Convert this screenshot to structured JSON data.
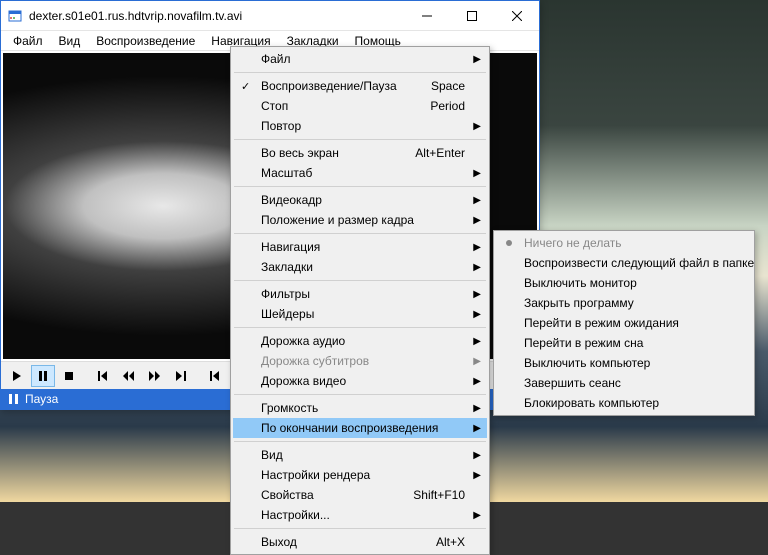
{
  "titlebar": {
    "title": "dexter.s01e01.rus.hdtvrip.novafilm.tv.avi"
  },
  "menubar": {
    "items": [
      "Файл",
      "Вид",
      "Воспроизведение",
      "Навигация",
      "Закладки",
      "Помощь"
    ]
  },
  "status": {
    "label": "Пауза"
  },
  "menu1": [
    {
      "label": "Файл",
      "arrow": true
    },
    {
      "sep": true
    },
    {
      "label": "Воспроизведение/Пауза",
      "shortcut": "Space",
      "checked": true
    },
    {
      "label": "Стоп",
      "shortcut": "Period"
    },
    {
      "label": "Повтор",
      "arrow": true
    },
    {
      "sep": true
    },
    {
      "label": "Во весь экран",
      "shortcut": "Alt+Enter"
    },
    {
      "label": "Масштаб",
      "arrow": true
    },
    {
      "sep": true
    },
    {
      "label": "Видеокадр",
      "arrow": true
    },
    {
      "label": "Положение и размер кадра",
      "arrow": true
    },
    {
      "sep": true
    },
    {
      "label": "Навигация",
      "arrow": true
    },
    {
      "label": "Закладки",
      "arrow": true
    },
    {
      "sep": true
    },
    {
      "label": "Фильтры",
      "arrow": true
    },
    {
      "label": "Шейдеры",
      "arrow": true
    },
    {
      "sep": true
    },
    {
      "label": "Дорожка аудио",
      "arrow": true
    },
    {
      "label": "Дорожка субтитров",
      "arrow": true,
      "disabled": true
    },
    {
      "label": "Дорожка видео",
      "arrow": true
    },
    {
      "sep": true
    },
    {
      "label": "Громкость",
      "arrow": true
    },
    {
      "label": "По окончании воспроизведения",
      "arrow": true,
      "highlight": true
    },
    {
      "sep": true
    },
    {
      "label": "Вид",
      "arrow": true
    },
    {
      "label": "Настройки рендера",
      "arrow": true
    },
    {
      "label": "Свойства",
      "shortcut": "Shift+F10"
    },
    {
      "label": "Настройки...",
      "arrow": true
    },
    {
      "sep": true
    },
    {
      "label": "Выход",
      "shortcut": "Alt+X"
    }
  ],
  "menu2": [
    {
      "label": "Ничего не делать",
      "radio": true,
      "disabled": true
    },
    {
      "label": "Воспроизвести следующий файл в папке"
    },
    {
      "label": "Выключить монитор"
    },
    {
      "label": "Закрыть программу"
    },
    {
      "label": "Перейти в режим ожидания"
    },
    {
      "label": "Перейти в режим сна"
    },
    {
      "label": "Выключить компьютер"
    },
    {
      "label": "Завершить сеанс"
    },
    {
      "label": "Блокировать компьютер"
    }
  ]
}
